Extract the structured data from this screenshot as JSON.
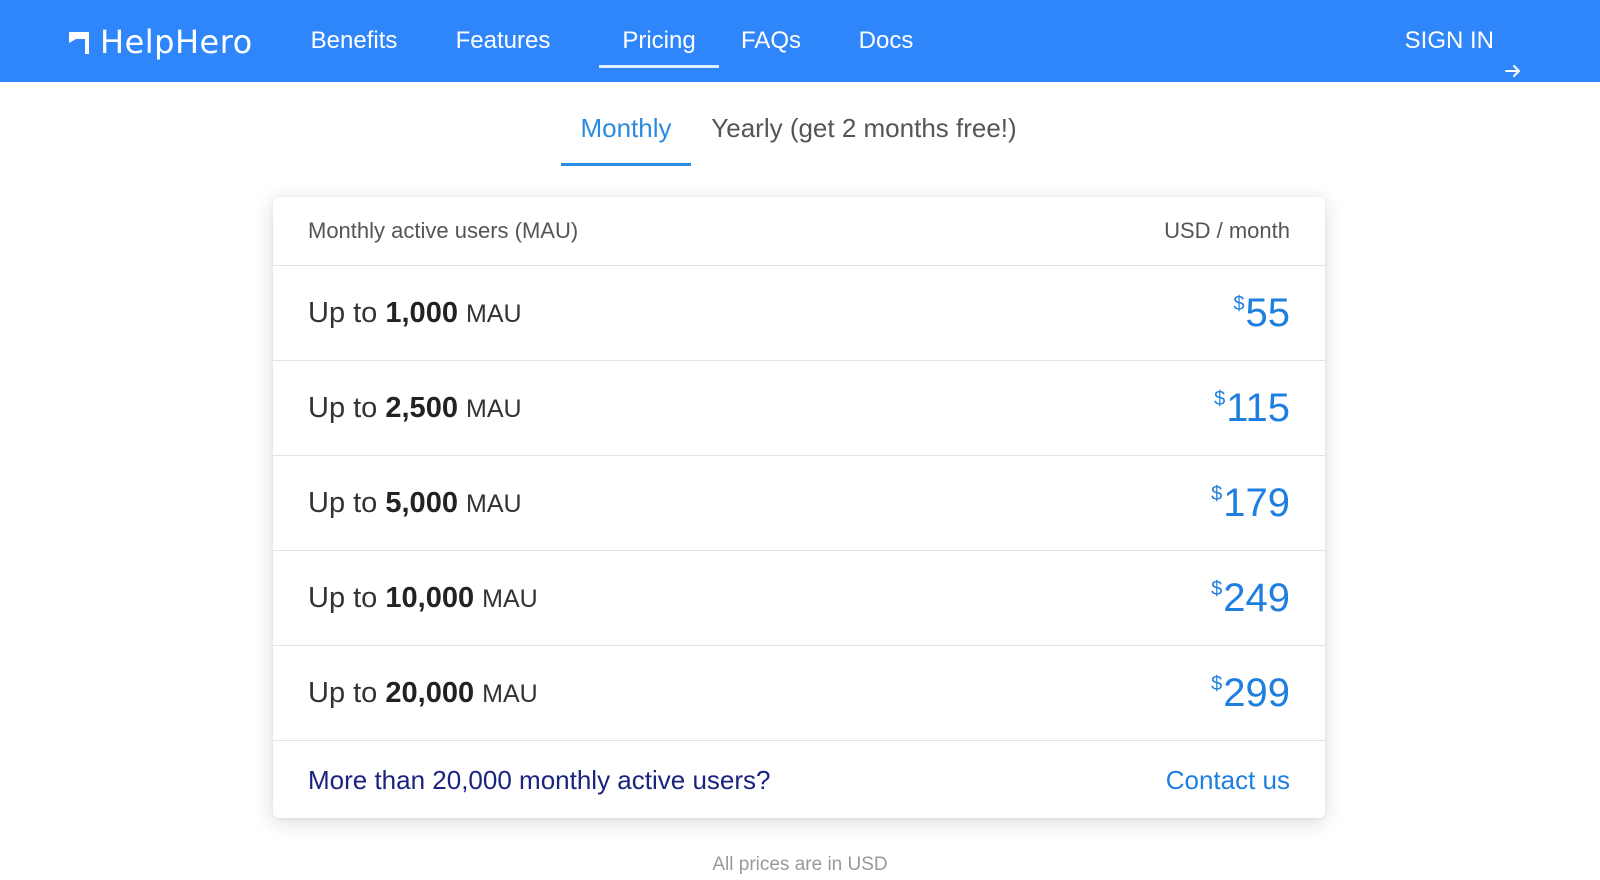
{
  "header": {
    "brand": "HelpHero",
    "nav": [
      {
        "label": "Benefits"
      },
      {
        "label": "Features"
      },
      {
        "label": "Pricing",
        "active": true
      },
      {
        "label": "FAQs"
      },
      {
        "label": "Docs"
      }
    ],
    "signin_label": "SIGN IN"
  },
  "billing": {
    "monthly_label": "Monthly",
    "yearly_label": "Yearly (get 2 months free!)",
    "active": "monthly"
  },
  "table": {
    "col_left": "Monthly active users (MAU)",
    "col_right": "USD / month",
    "rows": [
      {
        "prefix": "Up to ",
        "count": "1,000",
        "unit": "MAU",
        "currency": "$",
        "price": "55"
      },
      {
        "prefix": "Up to ",
        "count": "2,500",
        "unit": "MAU",
        "currency": "$",
        "price": "115"
      },
      {
        "prefix": "Up to ",
        "count": "5,000",
        "unit": "MAU",
        "currency": "$",
        "price": "179"
      },
      {
        "prefix": "Up to ",
        "count": "10,000",
        "unit": "MAU",
        "currency": "$",
        "price": "249"
      },
      {
        "prefix": "Up to ",
        "count": "20,000",
        "unit": "MAU",
        "currency": "$",
        "price": "299"
      }
    ],
    "footer_question": "More than 20,000 monthly active users?",
    "contact_label": "Contact us"
  },
  "note": "All prices are in USD",
  "colors": {
    "header_bg": "#2f86fb",
    "accent": "#1e7fe0",
    "tab_active": "#2b8cdf",
    "footer_text": "#1a237e"
  },
  "icons": {
    "logo": "flag-icon",
    "signin": "arrow-right-icon"
  }
}
